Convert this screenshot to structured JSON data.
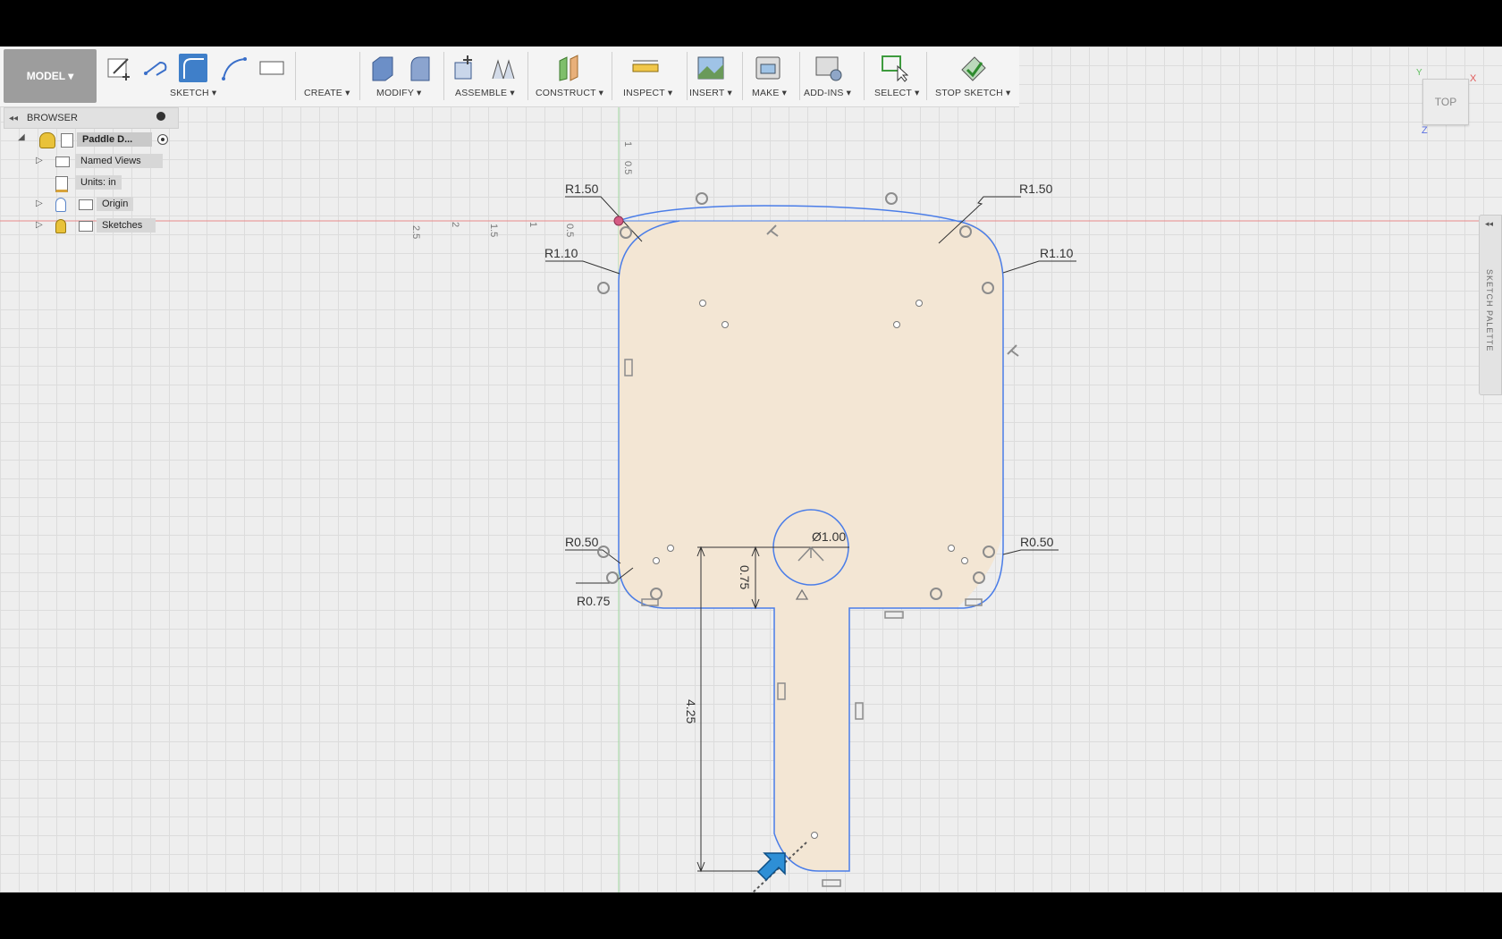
{
  "toolbar": {
    "mode_label": "MODEL ▾",
    "groups": [
      {
        "label": "SKETCH ▾"
      },
      {
        "label": "CREATE ▾"
      },
      {
        "label": "MODIFY ▾"
      },
      {
        "label": "ASSEMBLE ▾"
      },
      {
        "label": "CONSTRUCT ▾"
      },
      {
        "label": "INSPECT ▾"
      },
      {
        "label": "INSERT ▾"
      },
      {
        "label": "MAKE ▾"
      },
      {
        "label": "ADD-INS ▾"
      },
      {
        "label": "SELECT ▾"
      },
      {
        "label": "STOP SKETCH ▾"
      }
    ]
  },
  "browser": {
    "title": "BROWSER",
    "items": [
      {
        "label": "Paddle D..."
      },
      {
        "label": "Named Views"
      },
      {
        "label": "Units: in"
      },
      {
        "label": "Origin"
      },
      {
        "label": "Sketches"
      }
    ]
  },
  "viewcube": {
    "face": "TOP",
    "axis_x": "X",
    "axis_y": "Y",
    "axis_z": "Z"
  },
  "sketch_palette": {
    "label": "SKETCH PALETTE"
  },
  "ruler": {
    "vertical": [
      "1",
      "0.5"
    ],
    "horizontal": [
      "2.5",
      "2",
      "1.5",
      "1",
      "0.5"
    ]
  },
  "dimensions": {
    "r_top_left": "R1.50",
    "r_top_right": "R1.50",
    "r_mid_left": "R1.10",
    "r_mid_right": "R1.10",
    "r_bottom_left": "R0.50",
    "r_bottom_right": "R0.50",
    "r_handle_corner": "R0.75",
    "diameter": "Ø1.00",
    "offset_075": "0.75",
    "handle_len": "4.25"
  },
  "colors": {
    "sketch_line": "#4a7de8",
    "profile_fill": "#f3e6d4",
    "active_tool": "#3f7fc9",
    "x_axis": "#e88a8a",
    "y_axis": "#9fd79f"
  }
}
